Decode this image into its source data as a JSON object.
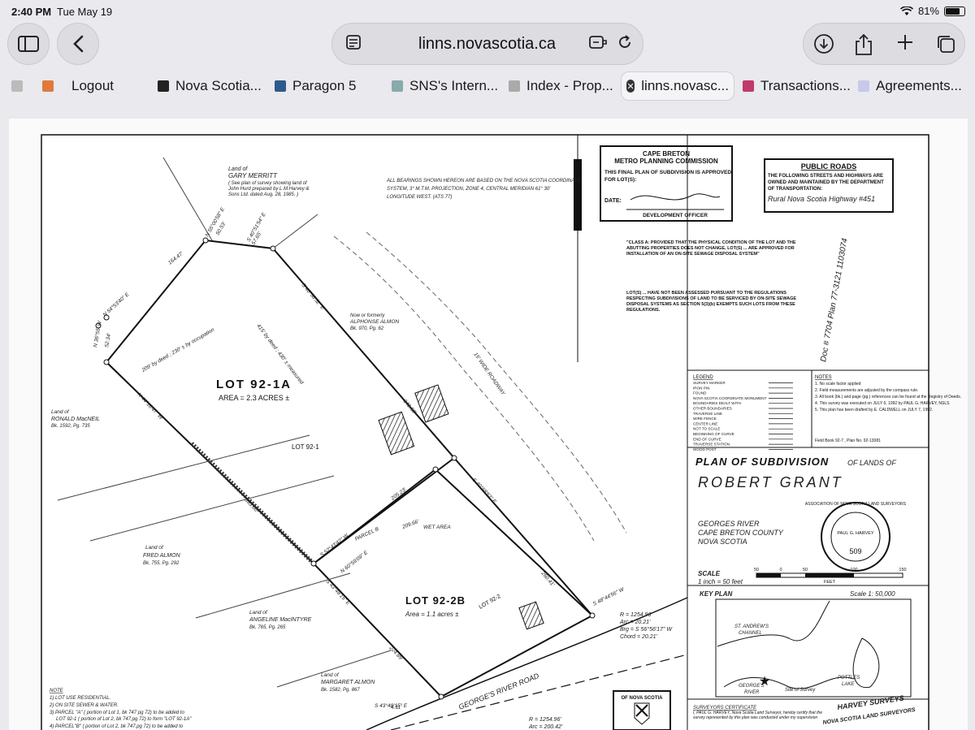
{
  "status_bar": {
    "time": "2:40 PM",
    "date": "Tue May 19",
    "wifi_icon": "wifi-icon",
    "battery": "81%",
    "battery_level": 0.81
  },
  "address_bar": {
    "url": "linns.novascotia.ca"
  },
  "tabs": [
    {
      "label": "Logout"
    },
    {
      "label": "Nova Scotia..."
    },
    {
      "label": "Paragon 5"
    },
    {
      "label": "SNS's Intern..."
    },
    {
      "label": "Index - Prop..."
    },
    {
      "label": "linns.novasc...",
      "active": true
    },
    {
      "label": "Transactions..."
    },
    {
      "label": "Agreements..."
    }
  ],
  "plan": {
    "top_left_owner": {
      "label": "Land of",
      "name": "GARY MERRITT",
      "note1": "( See plan of survey showing land of",
      "note2": "John Hurd prepared by L.M.Harvey &",
      "note3": "Sons Ltd. dated Aug. 28, 1985. )"
    },
    "bearing_note": {
      "line1": "ALL BEARINGS SHOWN HEREON ARE BASED ON THE NOVA SCOTIA COORDINATE",
      "line2": "SYSTEM, 3° M.T.M. PROJECTION, ZONE 4, CENTRAL MERIDIAN 61° 30'",
      "line3": "LONGITUDE WEST. (ATS 77)"
    },
    "approval_box": {
      "line1": "CAPE BRETON",
      "line2": "METRO PLANNING COMMISSION",
      "line3": "THIS FINAL PLAN OF SUBDIVISION IS APPROVED",
      "line4": "FOR LOT(S):",
      "date_label": "DATE:",
      "officer": "DEVELOPMENT OFFICER"
    },
    "public_roads": {
      "title": "PUBLIC ROADS",
      "line1": "THE FOLLOWING STREETS AND HIGHWAYS ARE",
      "line2": "OWNED AND MAINTAINED BY THE DEPARTMENT",
      "line3": "OF TRANSPORTATION:",
      "handwritten": "Rural Nova Scotia Highway #451"
    },
    "class_note": "\"CLASS A: PROVIDED THAT THE PHYSICAL CONDITION OF THE LOT AND THE ABUTTING PROPERTIES DOES NOT CHANGE, LOT(S) ... ARE APPROVED FOR INSTALLATION OF AN ON-SITE SEWAGE DISPOSAL SYSTEM\"",
    "lot_note": "LOT(S) ... HAVE NOT BEEN ASSESSED PURSUANT TO THE REGULATIONS RESPECTING SUBDIVISIONS OF LAND TO BE SERVICED BY ON-SITE SEWAGE DISPOSAL SYSTEMS AS SECTION 5(3)(b) EXEMPTS SUCH LOTS FROM THESE REGULATIONS.",
    "registry_handwritten": "Doc # 7704   Plan 77-3121   1103074",
    "lot_a": {
      "name": "LOT 92-1A",
      "area": "AREA = 2.3 ACRES ±"
    },
    "lot_b": {
      "name": "LOT 92-2B",
      "area": "Area = 1.1 acres ±"
    },
    "lot_faint_1": "LOT 92-1",
    "lot_faint_2": "LOT 92-2",
    "owners": [
      {
        "label": "Land of",
        "name": "RONALD MacNEIL",
        "ref": "Bk. 1592, Pg. 735"
      },
      {
        "label": "Land of",
        "name": "FRED ALMON",
        "ref": "Bk. 755, Pg. 292"
      },
      {
        "label": "Land of",
        "name": "ANGELINE MacINTYRE",
        "ref": "Bk. 765, Pg. 265"
      },
      {
        "label": "Land of",
        "name": "MARGARET ALMON",
        "ref": "Bk. 1582, Pg. 867"
      },
      {
        "label": "Now or formerly",
        "name": "ALPHONSE ALMON",
        "ref": "Bk. 970, Pg. 62"
      }
    ],
    "bearings": {
      "b1": "N 55°00'58\" E",
      "b2": "S 40°51'54\" E",
      "b3": "N 54°53'40\" E",
      "b4": "N 36°55' W",
      "b5": "S 40°58'52\" E",
      "b6": "N 44°18'47\" W",
      "b7": "S 52°43'42\" W",
      "b8": "N 60°59'09\" E",
      "b9": "S 43°48'15\" E",
      "b10": "S 48°44'56\" W",
      "b11": "S 43°48'15\" E",
      "b12": "S 40°58'52\" E",
      "d1": "164.47'",
      "d2": "50.53'",
      "d3": "57.65'",
      "d4": "52.34'",
      "d5": "363.60'",
      "d6": "205.23'",
      "d7": "209.66'",
      "d8": "224.89'",
      "d9": "260.41'",
      "d10": "340.50'",
      "d11": "4.11'",
      "deed1": "209' by deed ; 230' ± by occupation",
      "deed2": "415' by deed ; 430' ± measured",
      "parcel": "PARCEL B",
      "wet": "WET AREA",
      "roadway": "15' WIDE ROADWAY"
    },
    "road": {
      "name": "GEORGE'S RIVER ROAD",
      "curve1": "R = 1254.96'",
      "curve2": "Arc = 20.21'",
      "curve3": "Brg = S 56°56'17\" W",
      "curve4": "Chord = 20.21'",
      "curve5": "R = 1254.96'",
      "curve6": "Arc = 200.42'"
    },
    "notes_left": {
      "title": "NOTE",
      "n1": "1) LOT USE RESIDENTIAL.",
      "n2": "2) ON SITE SEWER & WATER.",
      "n3": "3) PARCEL \"A\" ( portion of Lot 1, bk 747 pg 72) to be added to",
      "n4": "LOT 92-1 ( portion of Lot 2, bk 747,pg 72) to form \"LOT 92-1A\"",
      "n5": "4) PARCEL\"B\" ( portion of Lot 2, bk 747,pg 72) to be added to"
    },
    "legend": {
      "title": "LEGEND",
      "items": [
        "SURVEY MARKER",
        "IRON PIN",
        "FOUND",
        "NOVA SCOTIA COORDINATE MONUMENT",
        "BOUNDARIES DEALT WITH",
        "OTHER BOUNDARIES",
        "TRAVERSE LINE",
        "WIRE FENCE",
        "CENTER LINE",
        "NOT TO SCALE",
        "BEGINNING OF CURVE",
        "END OF CURVE",
        "TRAVERSE STATION",
        "WOOD POST"
      ]
    },
    "notes_right": {
      "title": "NOTES",
      "n1": "1. No scale factor applied",
      "n2": "2. Field measurements are adjusted by the compass rule.",
      "n3": "3. All book (bk.) and page (pg.) references can be found at the Registry of Deeds.",
      "n4": "4. This survey was executed on JULY 6, 1992 by PAUL G. HARVEY, NSLS",
      "n5": "5. This plan has been drafted by E. CALDWELL on JULY 7, 1992.",
      "field": "Field Book 92-7 , Plan No. 92-13081"
    },
    "title_block": {
      "t1": "PLAN OF SUBDIVISION",
      "t2": "OF LANDS OF",
      "owner": "ROBERT GRANT",
      "loc1": "GEORGES RIVER",
      "loc2": "CAPE BRETON COUNTY",
      "loc3": "NOVA SCOTIA",
      "seal1": "ASSOCIATION OF NOVA SCOTIA LAND SURVEYORS",
      "seal2": "PAUL G. HARVEY",
      "seal3": "509",
      "scale_label": "SCALE",
      "scale_value": "1 inch = 50 feet",
      "scale_ticks": [
        "50",
        "0",
        "50",
        "100",
        "150"
      ],
      "scale_unit": "FEET"
    },
    "key_plan": {
      "title": "KEY PLAN",
      "scale": "Scale  1: 50,000",
      "l1": "ST. ANDREW'S",
      "l2": "CHANNEL",
      "l3": "POTTLES",
      "l4": "LAKE",
      "l5": "GEORGE'S",
      "l6": "RIVER",
      "l7": "Site of Survey"
    },
    "surveyor": {
      "title": "SURVEYORS CERTIFICATE",
      "text": "I, PAUL G. HARVEY, Nova Scotia Land Surveyor, hereby certify that the survey represented by this plan was conducted under my supervision",
      "firm1": "HARVEY SURVEYS",
      "firm2": "NOVA SCOTIA LAND SURVEYORS"
    },
    "crest_label": "OF NOVA SCOTIA"
  }
}
